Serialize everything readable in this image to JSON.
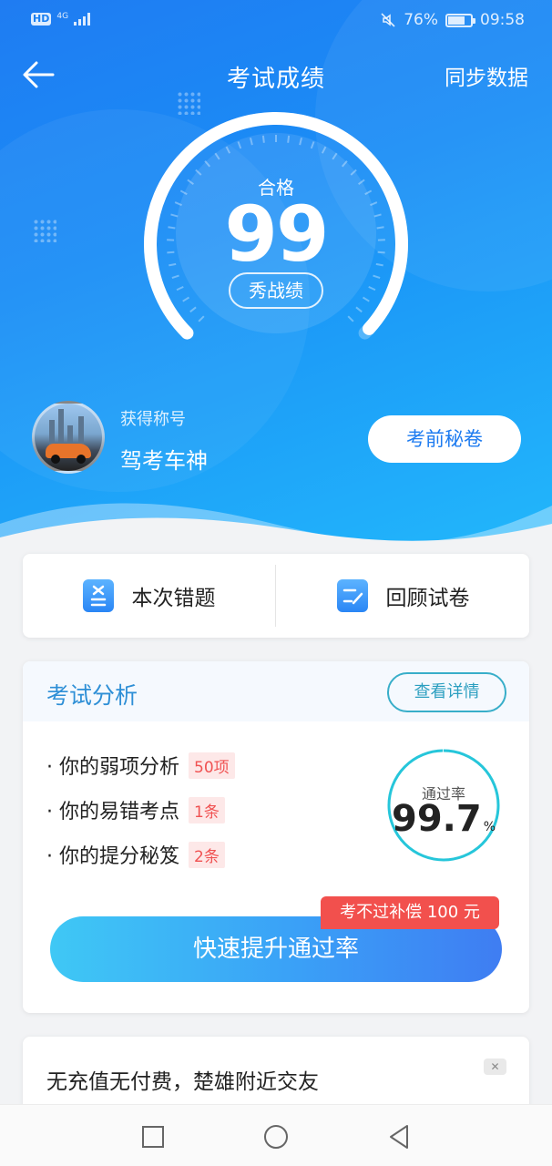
{
  "status_bar": {
    "hd": "HD",
    "network": "4G",
    "battery_percent": "76%",
    "battery_level": 0.76,
    "time": "09:58"
  },
  "header": {
    "title": "考试成绩",
    "sync_label": "同步数据",
    "back_icon": "arrow-left-icon"
  },
  "score_panel": {
    "pass_text": "合格",
    "score": "99",
    "score_value": 99,
    "share_label": "秀战绩"
  },
  "badge": {
    "label": "获得称号",
    "name": "驾考车神",
    "secret_button": "考前秘卷"
  },
  "quick_actions": [
    {
      "label": "本次错题",
      "icon": "wrong-questions-icon"
    },
    {
      "label": "回顾试卷",
      "icon": "review-paper-icon"
    }
  ],
  "analysis": {
    "title": "考试分析",
    "detail_button": "查看详情",
    "items": [
      {
        "label": "· 你的弱项分析",
        "tag": "50项"
      },
      {
        "label": "· 你的易错考点",
        "tag": "1条"
      },
      {
        "label": "· 你的提分秘笈",
        "tag": "2条"
      }
    ],
    "rate_label": "通过率",
    "rate_value": "99.7",
    "rate_unit": "%",
    "rate_fraction": 0.997,
    "boost_button": "快速提升通过率",
    "compensation_badge": "考不过补偿 100 元"
  },
  "ad": {
    "text": "无充值无付费，楚雄附近交友",
    "close_icon": "close-icon"
  },
  "colors": {
    "primary": "#1a8ef6",
    "accent_red": "#f2504d",
    "rate_ring": "#26c6da"
  }
}
